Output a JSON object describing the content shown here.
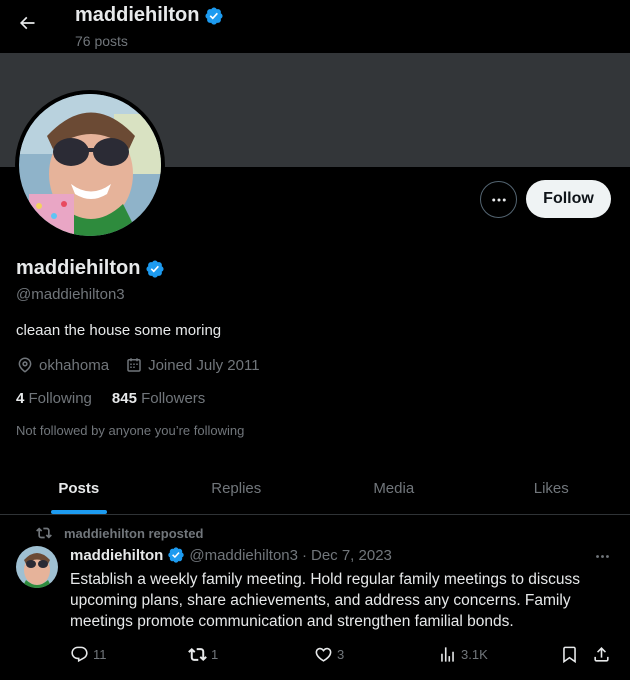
{
  "header": {
    "name": "maddiehilton",
    "posts_count": "76 posts"
  },
  "profile": {
    "display_name": "maddiehilton",
    "handle": "@maddiehilton3",
    "bio": "cleaan the house some moring",
    "location": "okhahoma",
    "joined": "Joined July 2011",
    "following_count": "4",
    "following_label": "Following",
    "followers_count": "845",
    "followers_label": "Followers",
    "not_followed_text": "Not followed by anyone you’re following",
    "follow_label": "Follow"
  },
  "tabs": [
    {
      "label": "Posts",
      "active": true
    },
    {
      "label": "Replies",
      "active": false
    },
    {
      "label": "Media",
      "active": false
    },
    {
      "label": "Likes",
      "active": false
    }
  ],
  "post": {
    "repost_text": "maddiehilton reposted",
    "name": "maddiehilton",
    "handle": "@maddiehilton3",
    "separator": "·",
    "date": "Dec 7, 2023",
    "text": "Establish a weekly family meeting. Hold regular family meetings to discuss upcoming plans, share achievements, and address any concerns. Family meetings promote communication and strengthen familial bonds.",
    "replies": "11",
    "reposts": "1",
    "likes": "3",
    "views": "3.1K"
  },
  "icons": {
    "back": "arrow-left-icon",
    "verified": "verified-badge-icon",
    "more": "more-horizontal-icon",
    "location": "location-pin-icon",
    "calendar": "calendar-icon",
    "repost": "repost-icon",
    "reply": "reply-icon",
    "like": "heart-icon",
    "views": "views-icon",
    "bookmark": "bookmark-icon",
    "share": "share-icon"
  },
  "colors": {
    "accent": "#1d9bf0",
    "background": "#000000",
    "banner": "#333639",
    "muted": "#71767b"
  }
}
